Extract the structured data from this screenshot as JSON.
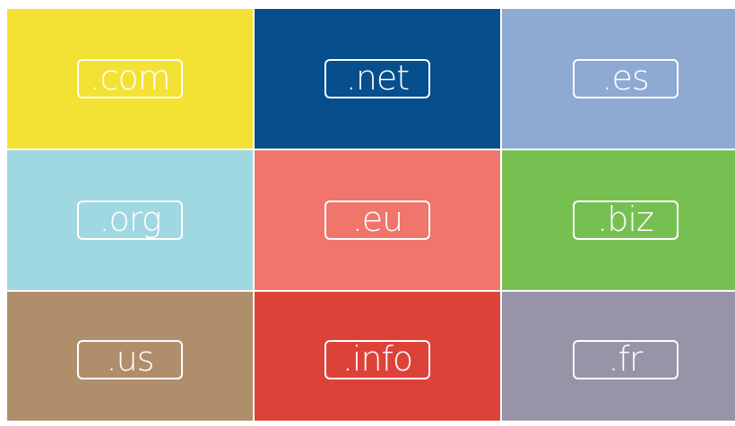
{
  "tiles": [
    {
      "label": ".com",
      "color": "#f3e234"
    },
    {
      "label": ".net",
      "color": "#074e8c"
    },
    {
      "label": ".es",
      "color": "#8ea9d2"
    },
    {
      "label": ".org",
      "color": "#9fd8e0"
    },
    {
      "label": ".eu",
      "color": "#f0756a"
    },
    {
      "label": ".biz",
      "color": "#76c052"
    },
    {
      "label": ".us",
      "color": "#b08e6b"
    },
    {
      "label": ".info",
      "color": "#dd4239"
    },
    {
      "label": ".fr",
      "color": "#9893a6"
    }
  ]
}
